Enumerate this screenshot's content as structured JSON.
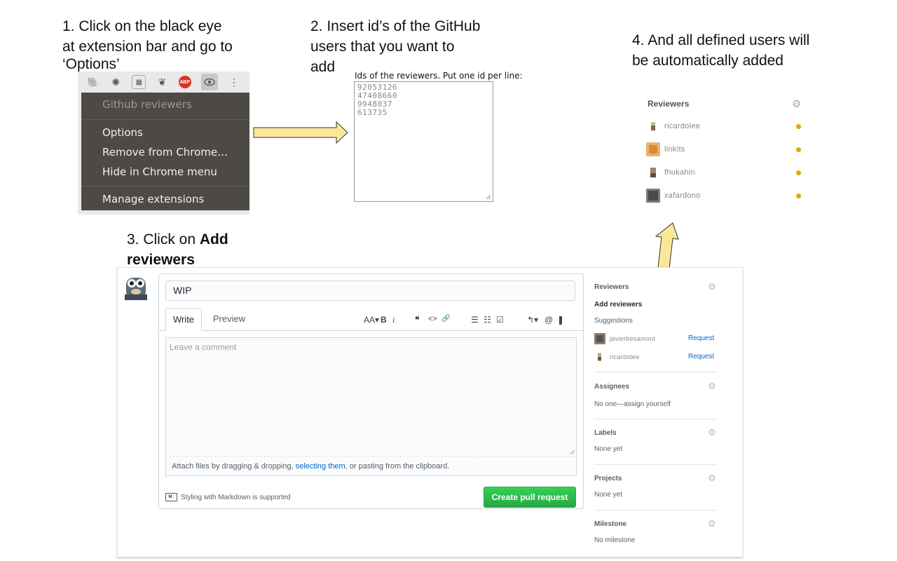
{
  "steps": {
    "step1": [
      "1. Click on the black eye",
      "at extension bar and go to",
      "‘Options’"
    ],
    "step2": [
      "2. Insert id’s of the GitHub",
      "users that you want to",
      "add"
    ],
    "step3_prefix": "3. Click on ",
    "step3_bold": "Add reviewers",
    "step4": [
      "4. And all defined users will",
      "be automatically added"
    ]
  },
  "chrome_menu": {
    "toolbar_icons": [
      "evernote-icon",
      "extension-icon",
      "chart-icon",
      "paw-icon",
      "adblock-icon",
      "eye-icon",
      "more-icon"
    ],
    "abp_label": "ABP",
    "extension_name": "Github reviewers",
    "items": [
      "Options",
      "Remove from Chrome…",
      "Hide in Chrome menu"
    ],
    "manage": "Manage extensions"
  },
  "options_page": {
    "label": "Ids of the reviewers. Put one id per line:",
    "ids": [
      "92053126",
      "47408660",
      "9948037",
      "613735"
    ]
  },
  "result_panel": {
    "title": "Reviewers",
    "reviewers": [
      "ricardolee",
      "linkits",
      "fhukahin",
      "xafardono"
    ],
    "status_color": "#dbab09"
  },
  "pr_form": {
    "title_value": "WIP",
    "tabs": [
      "Write",
      "Preview"
    ],
    "toolbar": {
      "heading": "AA▾",
      "bold": "B",
      "italic": "i",
      "quote": "❝",
      "code": "<>",
      "link": "🔗",
      "ul": "☰",
      "ol": "☷",
      "task": "☑",
      "reply": "↰▾",
      "mention": "@",
      "bookmark": "❚"
    },
    "comment_placeholder": "Leave a comment",
    "attach_before": "Attach files by dragging & dropping, ",
    "attach_link": "selecting them",
    "attach_after": ", or pasting from the clipboard.",
    "markdown_note": "Styling with Markdown is supported",
    "md_badge": "M↓",
    "create_button": "Create pull request"
  },
  "sidebar": {
    "reviewers_heading": "Reviewers",
    "add_reviewers": "Add reviewers",
    "suggestions_label": "Suggestions",
    "suggestions": [
      {
        "name": "javierbesamont",
        "action": "Request"
      },
      {
        "name": "ricardolee",
        "action": "Request"
      }
    ],
    "assignees_heading": "Assignees",
    "assignees_value": "No one—assign yourself",
    "labels_heading": "Labels",
    "labels_value": "None yet",
    "projects_heading": "Projects",
    "projects_value": "None yet",
    "milestone_heading": "Milestone",
    "milestone_value": "No milestone"
  },
  "colors": {
    "arrow_fill": "#fbe79a",
    "menu_bg": "#4d4a45",
    "create_button": "#2cbe4e",
    "link": "#0366d6"
  }
}
